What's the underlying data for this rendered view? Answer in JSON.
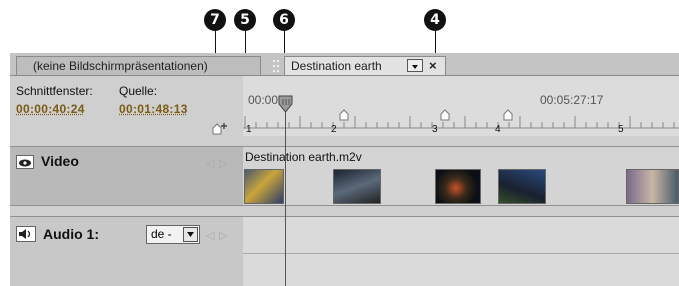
{
  "callouts": [
    "7",
    "5",
    "6",
    "4"
  ],
  "tabs": {
    "slideshow_tab": "(keine Bildschirmpräsentationen)",
    "project_tab": "Destination earth",
    "close_glyph": "×"
  },
  "info": {
    "monitor_label": "Schnittfenster:",
    "source_label": "Quelle:",
    "monitor_time": "00:00:40:24",
    "source_time": "00:01:48:13"
  },
  "ruler": {
    "start_time": "00:00",
    "end_time": "00:05:27:17",
    "chapters": [
      "1",
      "2",
      "3",
      "4",
      "5"
    ]
  },
  "video_track": {
    "name": "Video",
    "clip_name": "Destination earth.m2v",
    "icon": "eye-icon"
  },
  "audio_track": {
    "name": "Audio 1:",
    "language": "de -",
    "icon": "speaker-icon"
  },
  "colors": {
    "timecode": "#7a5c14",
    "playhead": "#555555"
  }
}
